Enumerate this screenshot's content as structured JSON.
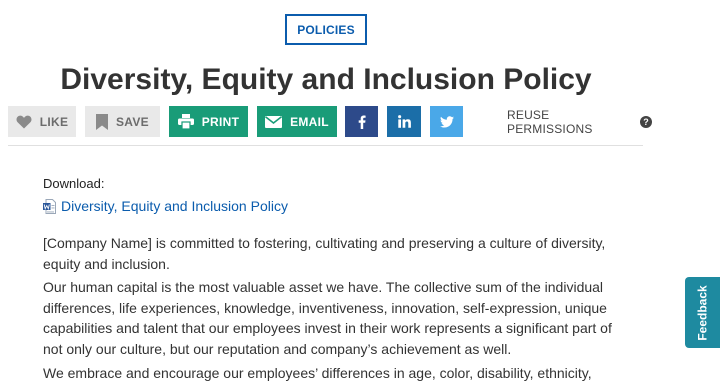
{
  "category": "POLICIES",
  "title": "Diversity, Equity and Inclusion Policy",
  "toolbar": {
    "like_label": "LIKE",
    "save_label": "SAVE",
    "print_label": "PRINT",
    "email_label": "EMAIL",
    "reuse_label": "REUSE PERMISSIONS",
    "help_glyph": "?",
    "icons": {
      "like": "heart-icon",
      "save": "bookmark-icon",
      "print": "printer-icon",
      "email": "envelope-icon",
      "facebook": "facebook-icon",
      "linkedin": "linkedin-icon",
      "twitter": "twitter-icon",
      "help": "question-circle-icon"
    }
  },
  "download": {
    "label": "Download:",
    "file_name": "Diversity, Equity and Inclusion Policy",
    "file_icon": "word-document-icon"
  },
  "body": {
    "paragraphs": [
      "[Company Name] is committed to fostering, cultivating and preserving a culture of diversity, equity and inclusion.",
      "Our human capital is the most valuable asset we have. The collective sum of the individual differences, life experiences, knowledge, inventiveness, innovation, self-expression, unique capabilities and talent that our employees invest in their work represents a significant part of not only our culture, but our reputation and company’s achievement as well.",
      "We embrace and encourage our employees’ differences in age, color, disability, ethnicity,"
    ]
  },
  "feedback_label": "Feedback",
  "colors": {
    "accent_blue": "#0b5cad",
    "green": "#199c78",
    "facebook": "#2d4a8a",
    "linkedin": "#1b6ea8",
    "twitter": "#4aa8e8",
    "feedback": "#1e8aa0",
    "gray_button": "#e9e9e9"
  }
}
